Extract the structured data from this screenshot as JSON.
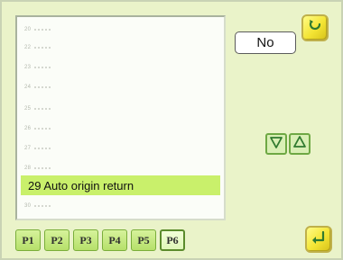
{
  "list": {
    "rows": [
      {
        "placeholder": "20"
      },
      {
        "placeholder": "22"
      },
      {
        "placeholder": "23"
      },
      {
        "placeholder": "24"
      },
      {
        "placeholder": "25"
      },
      {
        "placeholder": "26"
      },
      {
        "placeholder": "27"
      },
      {
        "placeholder": "28"
      }
    ],
    "selected_label": "29 Auto origin return",
    "after_placeholder": "30"
  },
  "value_box": {
    "value": "No"
  },
  "pages": [
    "P1",
    "P2",
    "P3",
    "P4",
    "P5",
    "P6"
  ],
  "active_page": "P6",
  "icons": {
    "top_right": "return-arrow-icon",
    "bottom_right": "enter-arrow-icon",
    "down": "triangle-down-icon",
    "up": "triangle-up-icon"
  },
  "colors": {
    "selection": "#c9f06b",
    "background": "#eaf3c9",
    "button_yellow": "#f3e433",
    "button_green": "#b6e06a"
  }
}
